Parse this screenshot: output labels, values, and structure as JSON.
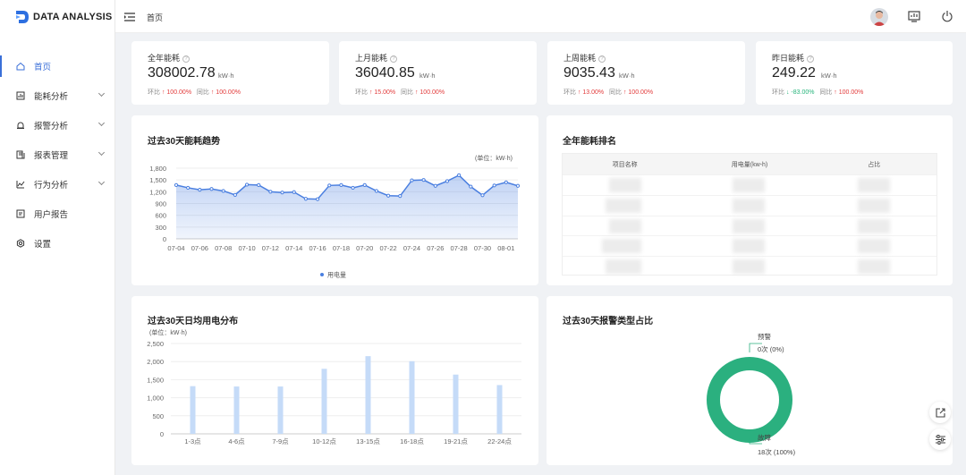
{
  "app": {
    "name": "DATA ANALYSIS",
    "breadcrumb": "首页"
  },
  "nav": [
    {
      "label": "首页",
      "active": true,
      "icon": "home-icon",
      "expandable": false
    },
    {
      "label": "能耗分析",
      "active": false,
      "icon": "energy-chart-icon",
      "expandable": true
    },
    {
      "label": "报警分析",
      "active": false,
      "icon": "alarm-icon",
      "expandable": true
    },
    {
      "label": "报表管理",
      "active": false,
      "icon": "report-icon",
      "expandable": true
    },
    {
      "label": "行为分析",
      "active": false,
      "icon": "behavior-icon",
      "expandable": true
    },
    {
      "label": "用户报告",
      "active": false,
      "icon": "user-report-icon",
      "expandable": false
    },
    {
      "label": "设置",
      "active": false,
      "icon": "settings-icon",
      "expandable": false
    }
  ],
  "kpis": [
    {
      "title": "全年能耗",
      "value": "308002.78",
      "unit": "kW·h",
      "mom_label": "环比",
      "mom_value": "100.00%",
      "mom_dir": "up",
      "yoy_label": "同比",
      "yoy_value": "100.00%",
      "yoy_dir": "up"
    },
    {
      "title": "上月能耗",
      "value": "36040.85",
      "unit": "kW·h",
      "mom_label": "环比",
      "mom_value": "15.00%",
      "mom_dir": "up",
      "yoy_label": "同比",
      "yoy_value": "100.00%",
      "yoy_dir": "up"
    },
    {
      "title": "上周能耗",
      "value": "9035.43",
      "unit": "kW·h",
      "mom_label": "环比",
      "mom_value": "13.00%",
      "mom_dir": "up",
      "yoy_label": "同比",
      "yoy_value": "100.00%",
      "yoy_dir": "up"
    },
    {
      "title": "昨日能耗",
      "value": "249.22",
      "unit": "kW·h",
      "mom_label": "环比",
      "mom_value": "-83.00%",
      "mom_dir": "down",
      "yoy_label": "同比",
      "yoy_value": "100.00%",
      "yoy_dir": "up"
    }
  ],
  "trend": {
    "title": "过去30天能耗趋势",
    "unit_note": "(单位：kW·h)",
    "legend": "用电量",
    "color": "#4a7fe0"
  },
  "ranking": {
    "title": "全年能耗排名",
    "columns": [
      "项目名称",
      "用电量(kw-h)",
      "占比"
    ]
  },
  "daily": {
    "title": "过去30天日均用电分布",
    "unit_note": "(单位：kW·h)",
    "color": "#c5dbf8"
  },
  "alarm": {
    "title": "过去30天报警类型占比",
    "color": "#2bb07f"
  },
  "chart_data": [
    {
      "type": "area",
      "title": "过去30天能耗趋势",
      "ylim": [
        0,
        1800
      ],
      "yticks": [
        "0",
        "300",
        "600",
        "900",
        "1,200",
        "1,500",
        "1,800"
      ],
      "xticks": [
        "07-04",
        "07-06",
        "07-08",
        "07-10",
        "07-12",
        "07-14",
        "07-16",
        "07-18",
        "07-20",
        "07-22",
        "07-24",
        "07-26",
        "07-28",
        "07-30",
        "08-01"
      ],
      "series": [
        {
          "name": "用电量",
          "values": [
            1370,
            1300,
            1250,
            1270,
            1220,
            1120,
            1380,
            1370,
            1200,
            1180,
            1190,
            1020,
            1010,
            1360,
            1370,
            1300,
            1370,
            1220,
            1100,
            1090,
            1490,
            1500,
            1350,
            1470,
            1620,
            1330,
            1110,
            1360,
            1440,
            1350
          ]
        }
      ]
    },
    {
      "type": "bar",
      "title": "过去30天日均用电分布",
      "ylim": [
        0,
        2500
      ],
      "yticks": [
        "0",
        "500",
        "1,000",
        "1,500",
        "2,000",
        "2,500"
      ],
      "categories": [
        "1-3点",
        "4-6点",
        "7-9点",
        "10-12点",
        "13-15点",
        "16-18点",
        "19-21点",
        "22-24点"
      ],
      "values": [
        1320,
        1310,
        1310,
        1800,
        2150,
        2010,
        1640,
        1350
      ]
    },
    {
      "type": "pie",
      "title": "过去30天报警类型占比",
      "slices": [
        {
          "name": "预警",
          "count_label": "0次 (0%)",
          "value": 0
        },
        {
          "name": "故障",
          "count_label": "18次 (100%)",
          "value": 18
        }
      ]
    }
  ]
}
